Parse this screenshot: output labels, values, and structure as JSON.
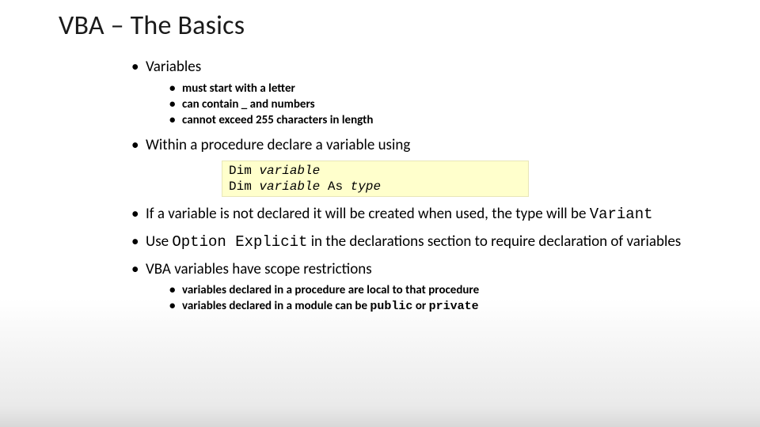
{
  "title": "VBA – The Basics",
  "bullets": {
    "variables": {
      "label": "Variables",
      "sub": [
        "must start with a letter",
        "can contain _ and numbers",
        "cannot exceed 255 characters in length"
      ]
    },
    "within": {
      "label": "Within a procedure declare a variable using"
    },
    "code": {
      "line1": {
        "kw": "Dim",
        "var": "variable"
      },
      "line2": {
        "kw1": "Dim",
        "var": "variable",
        "kw2": "As",
        "type": "type"
      }
    },
    "notdeclared": {
      "pre": "If a variable is not declared it will be created when used, the type will be ",
      "variant": "Variant"
    },
    "optexplicit": {
      "pre": "Use ",
      "code": "Option Explicit",
      "post": " in the declarations section to require declaration of variables"
    },
    "scope": {
      "label": "VBA variables have scope restrictions",
      "sub1": "variables declared in a procedure are local to that procedure",
      "sub2_pre": "variables declared in a module can be ",
      "sub2_public": "public",
      "sub2_mid": " or ",
      "sub2_private": "private"
    }
  }
}
